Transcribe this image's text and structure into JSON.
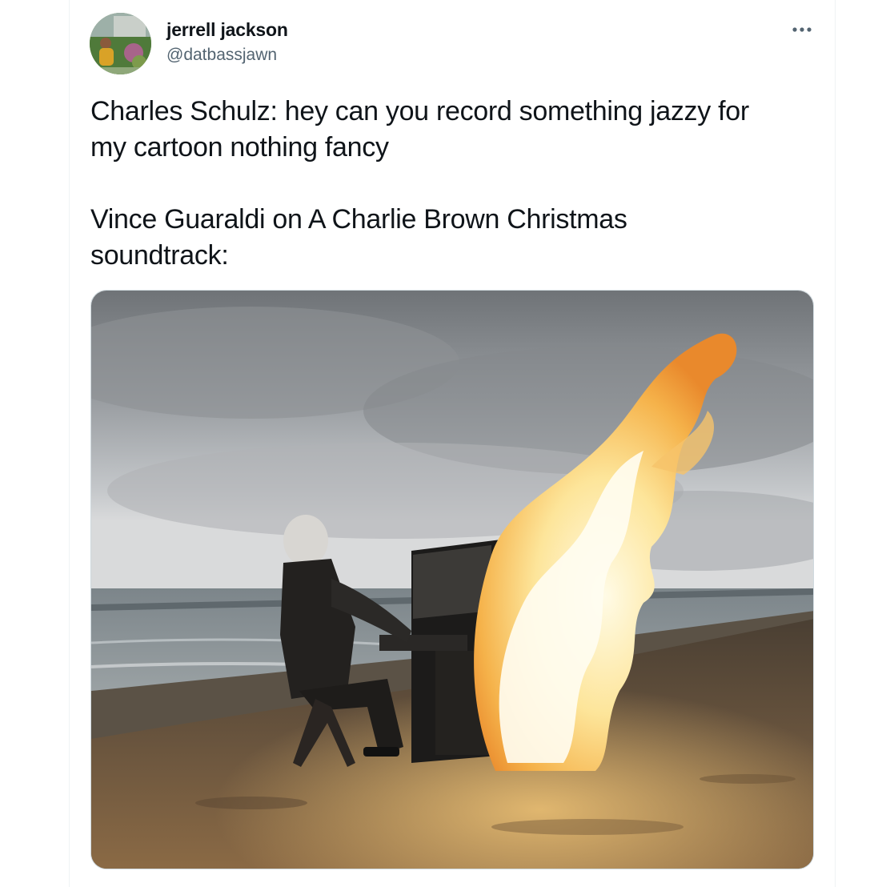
{
  "tweet": {
    "author": {
      "display_name": "jerrell jackson",
      "handle": "@datbassjawn",
      "avatar_icon": "user-avatar"
    },
    "more_icon": "more-options-icon",
    "text": "Charles Schulz: hey can you record something jazzy for\nmy cartoon nothing fancy\n\nVince Guaraldi on A Charlie Brown Christmas\nsoundtrack:",
    "media": {
      "type": "photo"
    }
  },
  "colors": {
    "text_primary": "#0f1419",
    "text_secondary": "#536471",
    "border": "#cfd9de"
  }
}
